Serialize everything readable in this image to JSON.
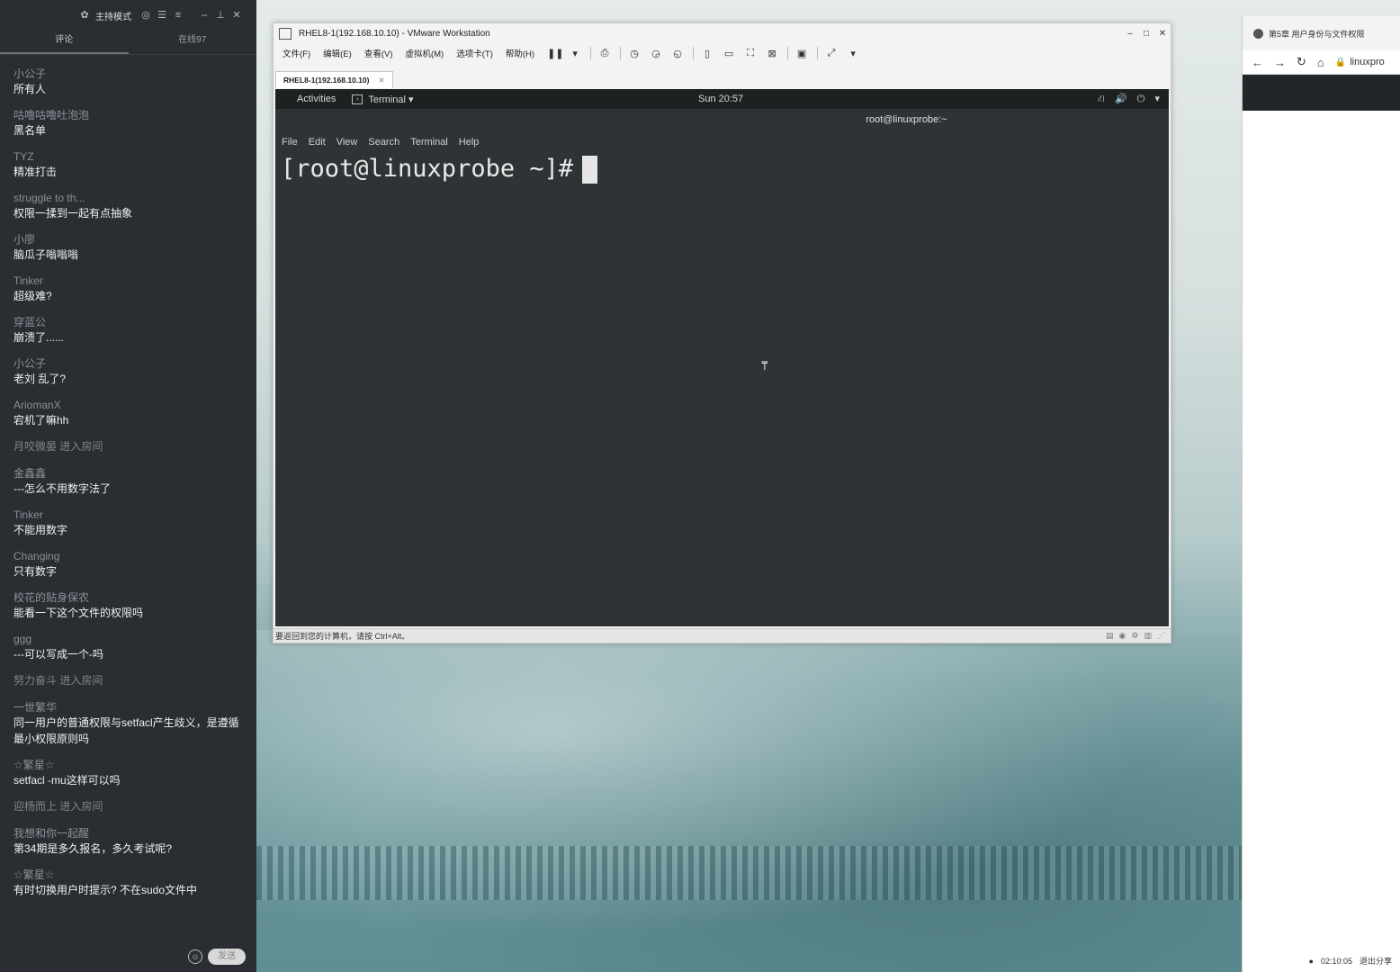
{
  "chat": {
    "header": {
      "mode_label": "主持模式"
    },
    "tabs": [
      "评论",
      "在线97"
    ],
    "messages": [
      {
        "user": "小公子",
        "text": "所有人"
      },
      {
        "user": "咕噜咕噜吐泡泡",
        "text": "黑名单"
      },
      {
        "user": "TYZ",
        "text": "精准打击"
      },
      {
        "user": "struggle to th...",
        "text": "权限一揉到一起有点抽象"
      },
      {
        "user": "小廖",
        "text": "脑瓜子嗡嗡嗡"
      },
      {
        "user": "Tinker",
        "text": "超级难?"
      },
      {
        "user": "穿蓝公",
        "text": "崩溃了......"
      },
      {
        "user": "小公子",
        "text": "老刘 乱了?"
      },
      {
        "user": "AriomanX",
        "text": "宕机了嘛hh"
      },
      {
        "system": "月咬微晏 进入房间"
      },
      {
        "user": "金鑫鑫",
        "text": "---怎么不用数字法了"
      },
      {
        "user": "Tinker",
        "text": "不能用数字"
      },
      {
        "user": "Changing",
        "text": "只有数字"
      },
      {
        "user": "校花的贴身保农",
        "text": "能看一下这个文件的权限吗"
      },
      {
        "user": "ggg",
        "text": "---可以写成一个-吗"
      },
      {
        "system": "努力奋斗 进入房间"
      },
      {
        "user": "一世繁华",
        "text": "同一用户的普通权限与setfacl产生歧义，是遵循最小权限原则吗"
      },
      {
        "user": "☆繁星☆",
        "text": "setfacl   -mu这样可以吗"
      },
      {
        "system": "迎杨而上 进入房间"
      },
      {
        "user": "我想和你一起醒",
        "text": "第34期是多久报名，多久考试呢?"
      },
      {
        "user": "☆繁星☆",
        "text": "有时切换用户时提示? 不在sudo文件中"
      }
    ],
    "send_label": "发送"
  },
  "vmware": {
    "title": "RHEL8-1(192.168.10.10) - VMware Workstation",
    "menu": [
      "文件(F)",
      "编辑(E)",
      "查看(V)",
      "虚拟机(M)",
      "选项卡(T)",
      "帮助(H)"
    ],
    "tab_label": "RHEL8-1(192.168.10.10)",
    "status_text": "要返回到您的计算机，请按 Ctrl+Alt。"
  },
  "guest": {
    "activities": "Activities",
    "app_menu": "Terminal ▾",
    "clock": "Sun 20:57",
    "window_title": "root@linuxprobe:~",
    "term_menu": [
      "File",
      "Edit",
      "View",
      "Search",
      "Terminal",
      "Help"
    ],
    "prompt": "[root@linuxprobe ~]#"
  },
  "browser": {
    "tab_title": "第5章 用户身份与文件权限",
    "url": "linuxpro",
    "timer": "02:10:05",
    "exit_share": "退出分享"
  },
  "icons": [
    "app-logo-icon",
    "settings-icon",
    "minimize-icon",
    "close-icon",
    "pause-icon",
    "snapshot-icon",
    "fullscreen-icon",
    "network-icon",
    "volume-icon",
    "power-icon",
    "back-icon",
    "forward-icon",
    "reload-icon",
    "home-icon",
    "lock-icon",
    "emoji-icon"
  ]
}
